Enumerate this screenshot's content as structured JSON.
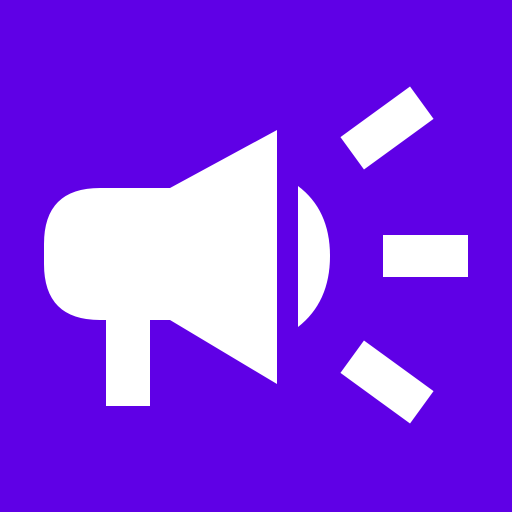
{
  "app_icon": {
    "icon": "megaphone-icon",
    "background_color": "#5f00e6",
    "foreground_color": "#ffffff"
  }
}
